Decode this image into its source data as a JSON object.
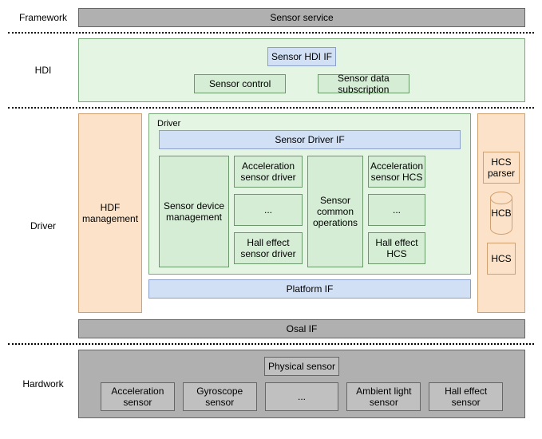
{
  "layers": {
    "framework": {
      "label": "Framework",
      "service": "Sensor service"
    },
    "hdi": {
      "label": "HDI",
      "if": "Sensor HDI IF",
      "control": "Sensor control",
      "sub": "Sensor data subscription"
    },
    "driver": {
      "label": "Driver",
      "hdf": "HDF management",
      "driverTitle": "Driver",
      "driverIf": "Sensor Driver IF",
      "sdm": "Sensor device management",
      "accelDriver": "Acceleration sensor driver",
      "ellipsis": "...",
      "hallDriver": "Hall effect sensor driver",
      "sco": "Sensor common operations",
      "accelHcs": "Acceleration sensor HCS",
      "hallHcs": "Hall effect HCS",
      "hcsParser": "HCS parser",
      "hcb": "HCB",
      "hcs": "HCS",
      "platformIf": "Platform IF",
      "osal": "Osal IF"
    },
    "hardwork": {
      "label": "Hardwork",
      "physical": "Physical sensor",
      "accel": "Acceleration sensor",
      "gyro": "Gyroscope sensor",
      "ellipsis": "...",
      "ambient": "Ambient light sensor",
      "hall": "Hall effect sensor"
    }
  }
}
